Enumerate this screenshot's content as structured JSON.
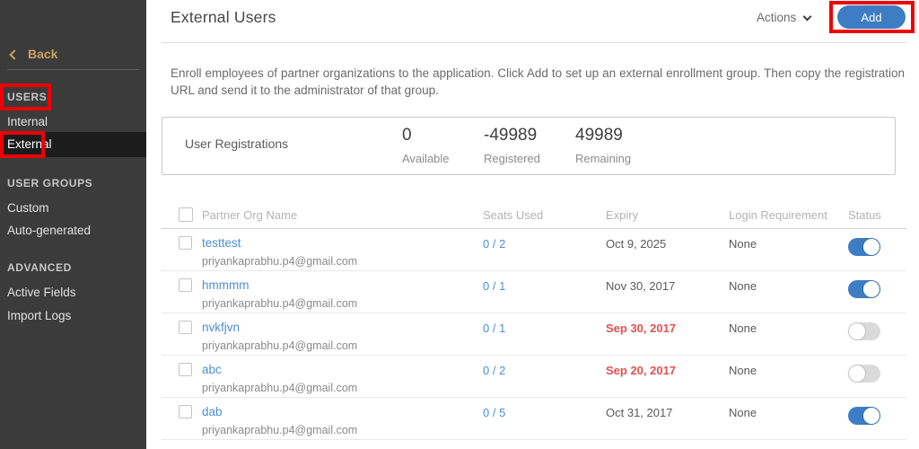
{
  "colors": {
    "sidebar_bg": "#3c3b3b",
    "sidebar_selected_bg": "#1d1c1c",
    "back_gold": "#c8a35f",
    "accent_blue": "#3d7dc4",
    "link_blue": "#4a8fd4",
    "expired_red": "#e25151",
    "annotation_red": "#ee0000"
  },
  "sidebar": {
    "back_label": "Back",
    "sections": [
      {
        "header": "USERS",
        "items": [
          {
            "label": "Internal"
          },
          {
            "label": "External",
            "selected": true
          }
        ]
      },
      {
        "header": "USER GROUPS",
        "items": [
          {
            "label": "Custom"
          },
          {
            "label": "Auto-generated"
          }
        ]
      },
      {
        "header": "ADVANCED",
        "items": [
          {
            "label": "Active Fields"
          },
          {
            "label": "Import Logs"
          }
        ]
      }
    ]
  },
  "header": {
    "title": "External Users",
    "actions_label": "Actions",
    "add_label": "Add"
  },
  "description": "Enroll employees of partner organizations to the application. Click Add to set up an external enrollment group. Then copy the registration URL and send it to the administrator of that group.",
  "registrations": {
    "label": "User Registrations",
    "stats": [
      {
        "value": "0",
        "label": "Available"
      },
      {
        "value": "-49989",
        "label": "Registered"
      },
      {
        "value": "49989",
        "label": "Remaining"
      }
    ]
  },
  "table": {
    "columns": {
      "name": "Partner Org Name",
      "seats": "Seats Used",
      "expiry": "Expiry",
      "login": "Login Requirement",
      "status": "Status"
    },
    "rows": [
      {
        "name": "testtest",
        "email": "priyankaprabhu.p4@gmail.com",
        "seats": "0 / 2",
        "expiry": "Oct 9, 2025",
        "expired": false,
        "login": "None",
        "enabled": true
      },
      {
        "name": "hmmmm",
        "email": "priyankaprabhu.p4@gmail.com",
        "seats": "0 / 1",
        "expiry": "Nov 30, 2017",
        "expired": false,
        "login": "None",
        "enabled": true
      },
      {
        "name": "nvkfjvn",
        "email": "priyankaprabhu.p4@gmail.com",
        "seats": "0 / 1",
        "expiry": "Sep 30, 2017",
        "expired": true,
        "login": "None",
        "enabled": false
      },
      {
        "name": "abc",
        "email": "priyankaprabhu.p4@gmail.com",
        "seats": "0 / 2",
        "expiry": "Sep 20, 2017",
        "expired": true,
        "login": "None",
        "enabled": false
      },
      {
        "name": "dab",
        "email": "priyankaprabhu.p4@gmail.com",
        "seats": "0 / 5",
        "expiry": "Oct 31, 2017",
        "expired": false,
        "login": "None",
        "enabled": true
      }
    ]
  }
}
